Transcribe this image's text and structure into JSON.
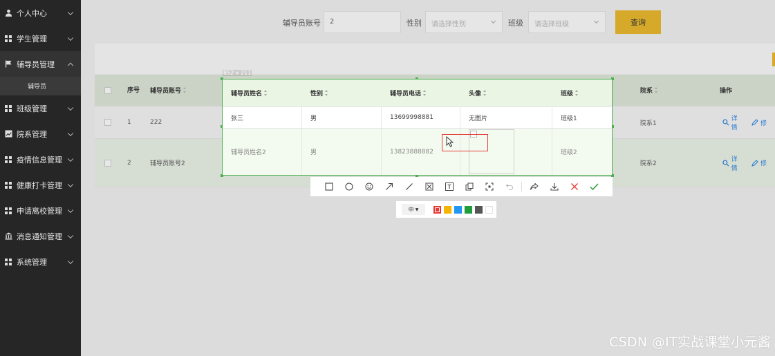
{
  "sidebar": {
    "items": [
      {
        "label": "个人中心",
        "icon": "user-icon"
      },
      {
        "label": "学生管理",
        "icon": "grid-icon"
      },
      {
        "label": "辅导员管理",
        "icon": "flag-icon",
        "expanded": true,
        "sub": "辅导员"
      },
      {
        "label": "班级管理",
        "icon": "grid-icon"
      },
      {
        "label": "院系管理",
        "icon": "chart-icon"
      },
      {
        "label": "疫情信息管理",
        "icon": "grid-icon"
      },
      {
        "label": "健康打卡管理",
        "icon": "grid-icon"
      },
      {
        "label": "申请离校管理",
        "icon": "grid-icon"
      },
      {
        "label": "消息通知管理",
        "icon": "bank-icon"
      },
      {
        "label": "系统管理",
        "icon": "grid-icon"
      }
    ]
  },
  "search": {
    "account_label": "辅导员账号",
    "account_value": "2",
    "gender_label": "性别",
    "gender_placeholder": "请选择性别",
    "class_label": "班级",
    "class_placeholder": "请选择班级",
    "query_label": "查询"
  },
  "table": {
    "headers": {
      "no": "序号",
      "account": "辅导员账号",
      "name": "辅导员姓名",
      "gender": "性别",
      "phone": "辅导员电话",
      "avatar": "头像",
      "class": "班级",
      "dept": "院系",
      "ops": "操作"
    },
    "rows": [
      {
        "no": "1",
        "account": "222",
        "name": "张三",
        "gender": "男",
        "phone": "13699998881",
        "avatar": "无图片",
        "class": "班级1",
        "dept": "院系1"
      },
      {
        "no": "2",
        "account": "辅导员账号2",
        "name": "辅导员姓名2",
        "gender": "男",
        "phone": "13823888882",
        "avatar": "",
        "class": "班级2",
        "dept": "院系2"
      }
    ],
    "op_detail": "详情",
    "op_edit": "修"
  },
  "capture": {
    "size_text": "852 x 211",
    "font_size_option": "中",
    "colors": [
      "#e53935",
      "#f5b400",
      "#2196f3",
      "#1e9e3a",
      "#555555",
      "#ffffff"
    ]
  },
  "watermark": "CSDN @IT实战课堂小元酱",
  "colors": {
    "accent": "#d6a92a",
    "selection": "#4caf50",
    "link": "#2f7ccf",
    "sidebar_bg": "#262626"
  }
}
